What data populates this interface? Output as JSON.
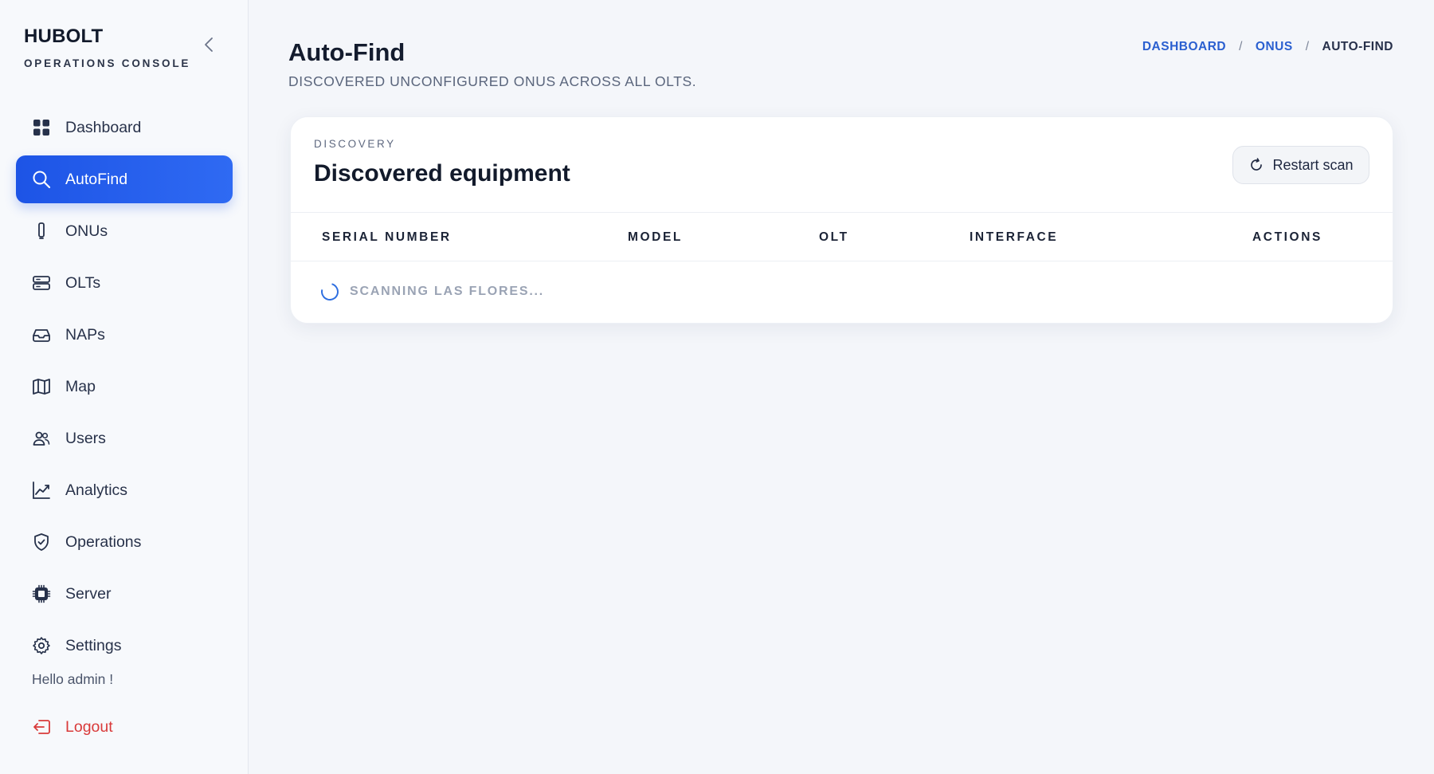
{
  "brand": {
    "title": "HUBOLT",
    "subtitle": "OPERATIONS CONSOLE"
  },
  "sidebar": {
    "items": [
      {
        "label": "Dashboard",
        "icon": "grid-icon",
        "active": false
      },
      {
        "label": "AutoFind",
        "icon": "search-icon",
        "active": true
      },
      {
        "label": "ONUs",
        "icon": "device-icon",
        "active": false
      },
      {
        "label": "OLTs",
        "icon": "server-stack-icon",
        "active": false
      },
      {
        "label": "NAPs",
        "icon": "inbox-icon",
        "active": false
      },
      {
        "label": "Map",
        "icon": "map-icon",
        "active": false
      },
      {
        "label": "Users",
        "icon": "users-icon",
        "active": false
      },
      {
        "label": "Analytics",
        "icon": "chart-icon",
        "active": false
      },
      {
        "label": "Operations",
        "icon": "shield-check-icon",
        "active": false
      },
      {
        "label": "Server",
        "icon": "cpu-chip-icon",
        "active": false
      },
      {
        "label": "Settings",
        "icon": "gear-icon",
        "active": false
      }
    ],
    "greeting": "Hello admin !",
    "logout_label": "Logout"
  },
  "header": {
    "title": "Auto-Find",
    "subtitle": "DISCOVERED UNCONFIGURED ONUS ACROSS ALL OLTS.",
    "breadcrumb": [
      "DASHBOARD",
      "ONUS",
      "AUTO-FIND"
    ],
    "breadcrumb_sep": "/"
  },
  "card": {
    "eyebrow": "DISCOVERY",
    "title": "Discovered equipment",
    "restart_label": "Restart scan",
    "columns": [
      "SERIAL NUMBER",
      "MODEL",
      "OLT",
      "INTERFACE",
      "ACTIONS"
    ],
    "status": "SCANNING LAS FLORES..."
  },
  "colors": {
    "accent": "#1d54e6",
    "logout": "#d93a3a",
    "link": "#2a5fd0",
    "background": "#f4f6fa"
  }
}
